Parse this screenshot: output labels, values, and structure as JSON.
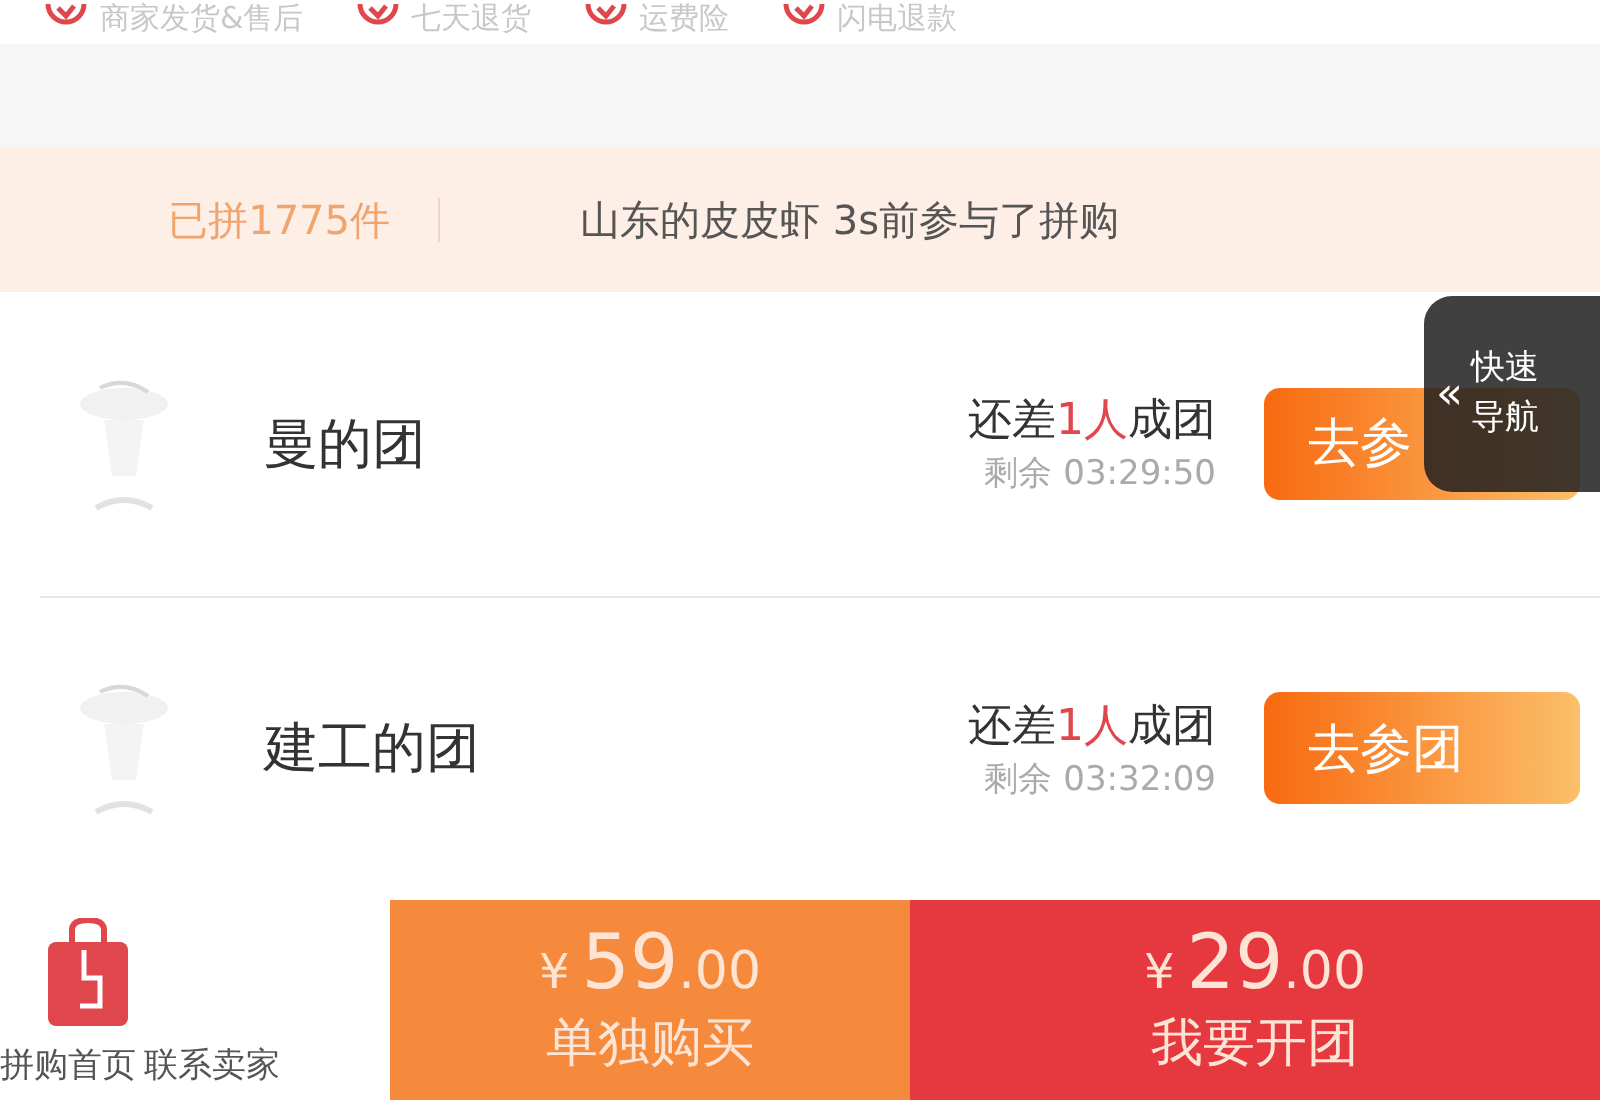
{
  "guarantees": [
    "商家发货&售后",
    "七天退货",
    "运费险",
    "闪电退款"
  ],
  "banner": {
    "count": "已拼1775件",
    "message": "山东的皮皮虾 3s前参与了拼购"
  },
  "groups": [
    {
      "name": "曼的团",
      "need_prefix": "还差",
      "need_count": "1人",
      "need_suffix": "成团",
      "remaining": "剩余 03:29:50",
      "button": "去参"
    },
    {
      "name": "建工的团",
      "need_prefix": "还差",
      "need_count": "1人",
      "need_suffix": "成团",
      "remaining": "剩余 03:32:09",
      "button": "去参团"
    }
  ],
  "quick_nav": {
    "arrow": "«",
    "label": "快速导航"
  },
  "bottom_bar": {
    "links": [
      "拼购首页",
      "联系卖家"
    ],
    "actions": [
      {
        "kind": "single",
        "currency": "¥",
        "integer": "59",
        "decimals": ".00",
        "label": "单独购买"
      },
      {
        "kind": "group",
        "currency": "¥",
        "integer": "29",
        "decimals": ".00",
        "label": "我要开团"
      }
    ]
  }
}
